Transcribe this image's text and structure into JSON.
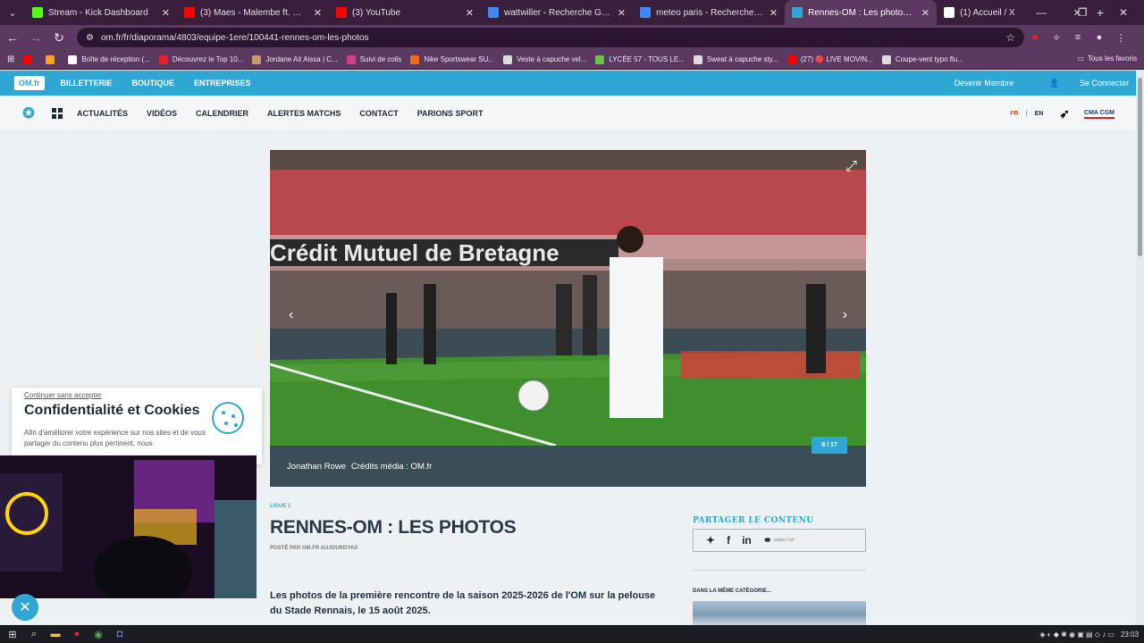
{
  "browser": {
    "tabs": [
      {
        "label": "Stream - Kick Dashboard",
        "color": "#53fc18",
        "active": false
      },
      {
        "label": "(3) Maes - Malembe ft. Gims (C",
        "color": "#ff0000",
        "active": false
      },
      {
        "label": "(3) YouTube",
        "color": "#ff0000",
        "active": false
      },
      {
        "label": "wattwiller - Recherche Google",
        "color": "#4285f4",
        "active": false
      },
      {
        "label": "meteo paris - Recherche Googl",
        "color": "#4285f4",
        "active": false
      },
      {
        "label": "Rennes-OM : Les photos - OM",
        "color": "#2fa7d4",
        "active": true
      },
      {
        "label": "(1) Accueil / X",
        "color": "#ffffff",
        "active": false
      }
    ],
    "url": "om.fr/fr/diaporama/4803/equipe-1ere/100441-rennes-om-les-photos",
    "bookmarks": [
      {
        "label": "Boîte de réception (...",
        "color": "#ffffff"
      },
      {
        "label": "Découvrez le Top 10...",
        "color": "#e4222a"
      },
      {
        "label": "Jordane Ait Aissa | C...",
        "color": "#c49a6c"
      },
      {
        "label": "Suivi de colis",
        "color": "#d63c8c"
      },
      {
        "label": "Nike Sportswear SU...",
        "color": "#f26b1d"
      },
      {
        "label": "Veste à capuche vel...",
        "color": "#dddddd"
      },
      {
        "label": "LYCÉE 57 - TOUS LE...",
        "color": "#6fbf4a"
      },
      {
        "label": "Sweat à capuche sty...",
        "color": "#dddddd"
      },
      {
        "label": "(27) 🔴 LIVE MOVIN...",
        "color": "#ff0000"
      },
      {
        "label": "Coupe-vent typo flu...",
        "color": "#dddddd"
      }
    ],
    "all_bookmarks": "Tous les favoris"
  },
  "site": {
    "topbar": {
      "badge": "OM.fr",
      "links": [
        "BILLETTERIE",
        "BOUTIQUE",
        "ENTREPRISES"
      ],
      "member": "Devenir Membre",
      "login": "Se Connecter"
    },
    "nav": {
      "links": [
        "ACTUALITÉS",
        "VIDÉOS",
        "CALENDRIER",
        "ALERTES MATCHS",
        "CONTACT",
        "PARIONS SPORT"
      ],
      "lang_fr": "FR",
      "lang_en": "EN",
      "sponsor": "CMA CGM"
    }
  },
  "slideshow": {
    "counter": "8 / 17",
    "caption_name": "Jonathan Rowe",
    "caption_credit": "Crédits média : OM.fr",
    "banner_text": "Crédit Mutuel de Bretagne"
  },
  "article": {
    "category": "LIGUE 1",
    "title": "RENNES-OM : LES PHOTOS",
    "byline": "POSTÉ PAR  OM.FR  AUJOURD'HUI",
    "lead": "Les photos de la première rencontre de la saison 2025-2026 de l'OM sur la pelouse du Stade Rennais, le 15 août 2025.",
    "share_title": "PARTAGER LE CONTENU",
    "copy_link": "copier l'url",
    "same_category": "DANS LA MÊME CATÉGORIE..."
  },
  "cookie": {
    "continue": "Continuer sans accepter",
    "title": "Confidentialité et Cookies",
    "text": "Afin d'améliorer votre expérience sur nos sites et de vous partager du contenu plus pertinent, nous"
  },
  "taskbar": {
    "time": "23:03"
  }
}
